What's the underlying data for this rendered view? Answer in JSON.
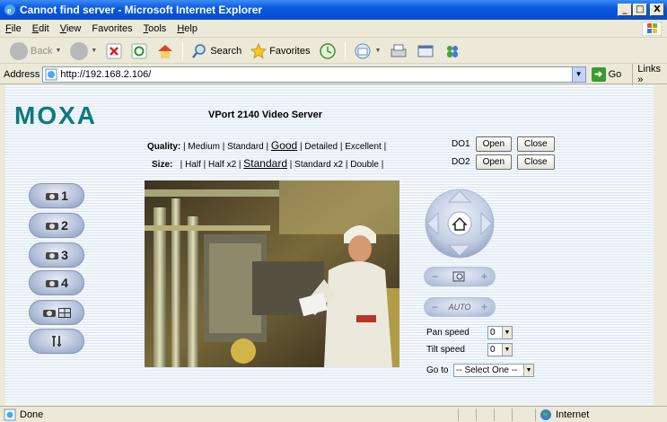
{
  "window": {
    "title": "Cannot find server - Microsoft Internet Explorer",
    "minimize": "_",
    "maximize": "□",
    "close": "X"
  },
  "menu": {
    "items": [
      {
        "key": "F",
        "rest": "ile"
      },
      {
        "key": "E",
        "rest": "dit"
      },
      {
        "key": "V",
        "rest": "iew"
      },
      {
        "key": "",
        "rest": "Favorites"
      },
      {
        "key": "T",
        "rest": "ools"
      },
      {
        "key": "H",
        "rest": "elp"
      }
    ]
  },
  "toolbar": {
    "back": "Back",
    "search": "Search",
    "favorites": "Favorites"
  },
  "address": {
    "label": "Address",
    "url": "http://192.168.2.106/",
    "go": "Go",
    "links": "Links »"
  },
  "page": {
    "logo": "MOXA",
    "title": "VPort 2140 Video Server",
    "quality": {
      "label": "Quality:",
      "options": [
        "Medium",
        "Standard",
        "Good",
        "Detailed",
        "Excellent"
      ],
      "selected": "Good"
    },
    "size": {
      "label": "Size:",
      "options": [
        "Half",
        "Half x2",
        "Standard",
        "Standard x2",
        "Double"
      ],
      "selected": "Standard"
    },
    "do1": {
      "label": "DO1",
      "open": "Open",
      "close": "Close"
    },
    "do2": {
      "label": "DO2",
      "open": "Open",
      "close": "Close"
    },
    "cameras": [
      "1",
      "2",
      "3",
      "4"
    ],
    "ptz": {
      "pan_label": "Pan speed",
      "pan_value": "0",
      "tilt_label": "Tilt speed",
      "tilt_value": "0",
      "goto_label": "Go to",
      "goto_value": "-- Select One --",
      "auto_label": "AUTO"
    }
  },
  "status": {
    "text": "Done",
    "zone": "Internet"
  },
  "colors": {
    "titlebar": "#0a5ae0",
    "moxa": "#0e7a7e"
  }
}
